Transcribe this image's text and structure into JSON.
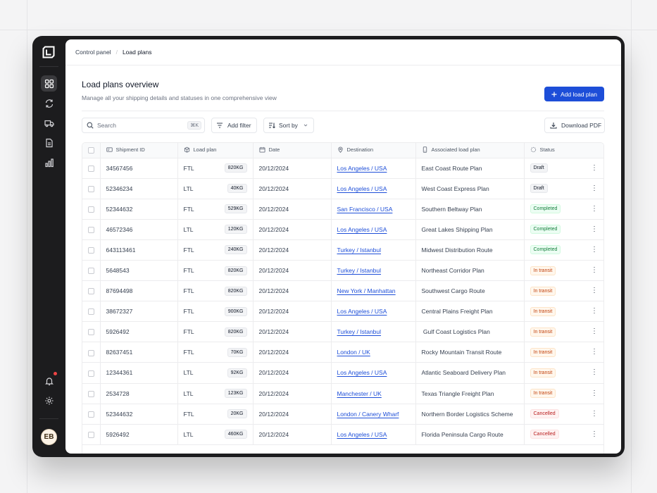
{
  "breadcrumb": {
    "parent": "Control panel",
    "separator": "/",
    "current": "Load plans"
  },
  "header": {
    "title": "Load plans overview",
    "subtitle": "Manage all your shipping details and statuses in one comprehensive view",
    "add_button_label": "Add load plan"
  },
  "toolbar": {
    "search_placeholder": "Search",
    "search_shortcut": "⌘K",
    "add_filter_label": "Add filter",
    "sort_label": "Sort by",
    "download_label": "Download PDF"
  },
  "table": {
    "columns": [
      "Shipment ID",
      "Load plan",
      "Date",
      "Destination",
      "Associated load plan",
      "Status"
    ],
    "rows": [
      {
        "id": "34567456",
        "plan": "FTL",
        "weight": "820KG",
        "date": "20/12/2024",
        "dest": "Los Angeles / USA",
        "assoc": "East Coast Route Plan",
        "status": "Draft",
        "kind": "draft"
      },
      {
        "id": "52346234",
        "plan": "LTL",
        "weight": "40KG",
        "date": "20/12/2024",
        "dest": "Los Angeles / USA",
        "assoc": "West Coast Express Plan",
        "status": "Draft",
        "kind": "draft"
      },
      {
        "id": "52344632",
        "plan": "FTL",
        "weight": "529KG",
        "date": "20/12/2024",
        "dest": "San Francisco / USA",
        "assoc": "Southern Beltway Plan",
        "status": "Completed",
        "kind": "completed"
      },
      {
        "id": "46572346",
        "plan": "LTL",
        "weight": "120KG",
        "date": "20/12/2024",
        "dest": "Los Angeles / USA",
        "assoc": "Great Lakes Shipping Plan",
        "status": "Completed",
        "kind": "completed"
      },
      {
        "id": "643113461",
        "plan": "FTL",
        "weight": "240KG",
        "date": "20/12/2024",
        "dest": "Turkey / Istanbul",
        "assoc": "Midwest Distribution Route",
        "status": "Completed",
        "kind": "completed"
      },
      {
        "id": "5648543",
        "plan": "FTL",
        "weight": "820KG",
        "date": "20/12/2024",
        "dest": "Turkey / Istanbul",
        "assoc": "Northeast Corridor Plan",
        "status": "In transit",
        "kind": "transit"
      },
      {
        "id": "87694498",
        "plan": "FTL",
        "weight": "820KG",
        "date": "20/12/2024",
        "dest": "New York / Manhattan",
        "assoc": "Southwest Cargo Route",
        "status": "In transit",
        "kind": "transit"
      },
      {
        "id": "38672327",
        "plan": "FTL",
        "weight": "900KG",
        "date": "20/12/2024",
        "dest": "Los Angeles / USA",
        "assoc": "Central Plains Freight Plan",
        "status": "In transit",
        "kind": "transit"
      },
      {
        "id": "5926492",
        "plan": "FTL",
        "weight": "820KG",
        "date": "20/12/2024",
        "dest": "Turkey / Istanbul",
        "assoc": " Gulf Coast Logistics Plan",
        "status": "In transit",
        "kind": "transit"
      },
      {
        "id": "82637451",
        "plan": "FTL",
        "weight": "70KG",
        "date": "20/12/2024",
        "dest": "London / UK",
        "assoc": "Rocky Mountain Transit Route",
        "status": "In transit",
        "kind": "transit"
      },
      {
        "id": "12344361",
        "plan": "LTL",
        "weight": "92KG",
        "date": "20/12/2024",
        "dest": "Los Angeles / USA",
        "assoc": "Atlantic Seaboard Delivery Plan",
        "status": "In transit",
        "kind": "transit"
      },
      {
        "id": "2534728",
        "plan": "LTL",
        "weight": "123KG",
        "date": "20/12/2024",
        "dest": "Manchester / UK",
        "assoc": "Texas Triangle Freight Plan",
        "status": "In transit",
        "kind": "transit"
      },
      {
        "id": "52344632",
        "plan": "FTL",
        "weight": "20KG",
        "date": "20/12/2024",
        "dest": "London / Canery Wharf",
        "assoc": "Northern Border Logistics Scheme",
        "status": "Cancelled",
        "kind": "cancelled"
      },
      {
        "id": "5926492",
        "plan": "LTL",
        "weight": "460KG",
        "date": "20/12/2024",
        "dest": "Los Angeles / USA",
        "assoc": "Florida Peninsula Cargo Route",
        "status": "Cancelled",
        "kind": "cancelled"
      }
    ]
  },
  "user": {
    "initials": "EB"
  },
  "colors": {
    "primary": "#1d4ed8",
    "rail": "#1c1c1e"
  }
}
